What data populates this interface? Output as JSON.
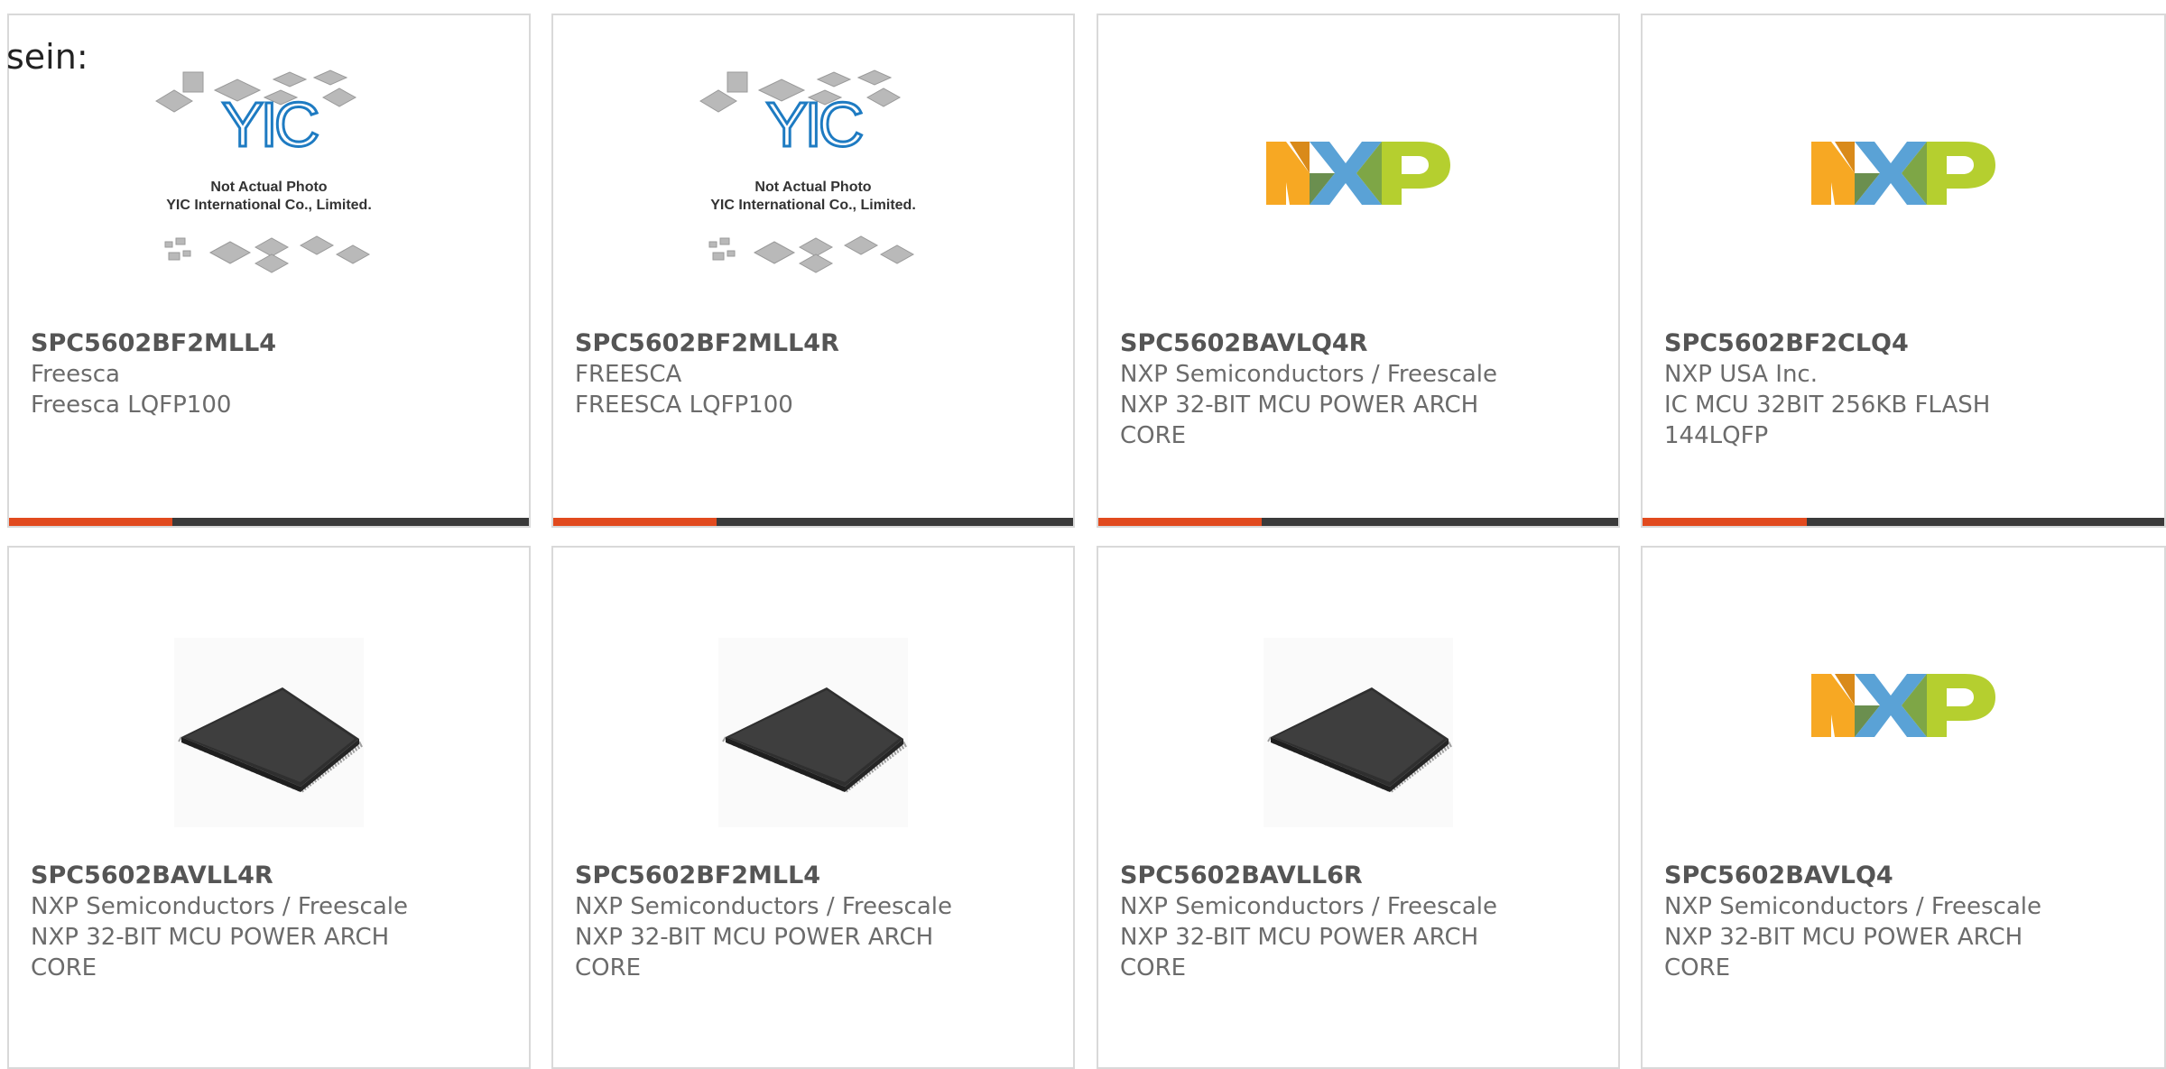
{
  "intro_text": "sein:",
  "colors": {
    "accent": "#e14a1e",
    "bar_dark": "#3a3a3a",
    "nxp_orange": "#f7a823",
    "nxp_blue": "#5aa2d6",
    "nxp_green": "#b5cf2f",
    "yic_blue": "#1e7bc2"
  },
  "yic_caption": {
    "line1": "Not Actual Photo",
    "line2": "YIC International Co., Limited."
  },
  "products": [
    {
      "part": "SPC5602BF2MLL4",
      "manufacturer": "Freesca",
      "description": "Freesca LQFP100",
      "image": "yic-placeholder",
      "accent_bar": true
    },
    {
      "part": "SPC5602BF2MLL4R",
      "manufacturer": "FREESCA",
      "description": "FREESCA LQFP100",
      "image": "yic-placeholder",
      "accent_bar": true
    },
    {
      "part": "SPC5602BAVLQ4R",
      "manufacturer": "NXP Semiconductors / Freescale",
      "description": "NXP 32-BIT MCU POWER ARCH CORE",
      "image": "nxp-logo",
      "accent_bar": true
    },
    {
      "part": "SPC5602BF2CLQ4",
      "manufacturer": "NXP USA Inc.",
      "description": "IC MCU 32BIT 256KB FLASH 144LQFP",
      "image": "nxp-logo",
      "accent_bar": true
    },
    {
      "part": "SPC5602BAVLL4R",
      "manufacturer": "NXP Semiconductors / Freescale",
      "description": "NXP 32-BIT MCU POWER ARCH CORE",
      "image": "lqfp-chip",
      "accent_bar": false
    },
    {
      "part": "SPC5602BF2MLL4",
      "manufacturer": "NXP Semiconductors / Freescale",
      "description": "NXP 32-BIT MCU POWER ARCH CORE",
      "image": "lqfp-chip",
      "accent_bar": false
    },
    {
      "part": "SPC5602BAVLL6R",
      "manufacturer": "NXP Semiconductors / Freescale",
      "description": "NXP 32-BIT MCU POWER ARCH CORE",
      "image": "lqfp-chip",
      "accent_bar": false
    },
    {
      "part": "SPC5602BAVLQ4",
      "manufacturer": "NXP Semiconductors / Freescale",
      "description": "NXP 32-BIT MCU POWER ARCH CORE",
      "image": "nxp-logo",
      "accent_bar": false
    }
  ]
}
